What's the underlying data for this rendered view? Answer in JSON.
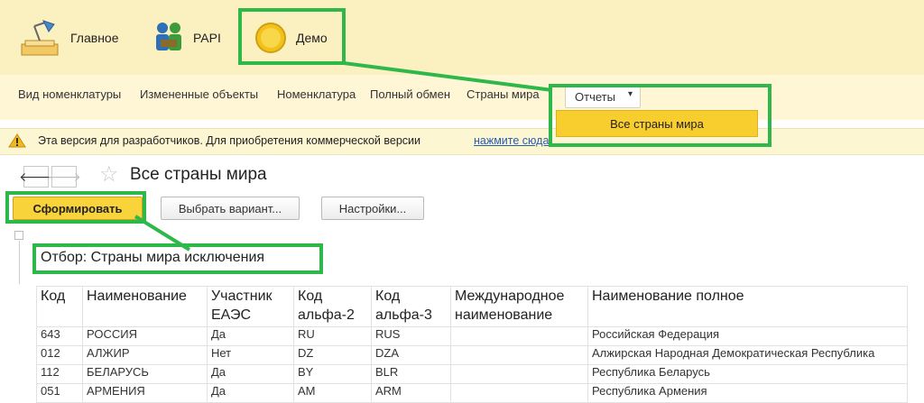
{
  "sections": [
    {
      "label": "Главное",
      "icon": "desk-lamp-icon"
    },
    {
      "label": "PAPI",
      "icon": "people-puzzle-icon"
    },
    {
      "label": "Демо",
      "icon": "yellow-circle-icon"
    }
  ],
  "nav": {
    "items": [
      "Вид номенклатуры",
      "Измененные объекты",
      "Номенклатура",
      "Полный обмен",
      "Страны мира"
    ],
    "reports_label": "Отчеты",
    "dropdown_item": "Все страны мира"
  },
  "warning": {
    "text": "Эта версия для разработчиков. Для приобретения коммерческой версии",
    "link": "нажмите сюда"
  },
  "form": {
    "title": "Все страны мира",
    "buttons": {
      "generate": "Сформировать",
      "choose_variant": "Выбрать вариант...",
      "settings": "Настройки..."
    }
  },
  "report": {
    "filter": "Отбор:   Страны мира исключения",
    "headers": [
      [
        "Код"
      ],
      [
        "Наименование"
      ],
      [
        "Участник",
        "ЕАЭС"
      ],
      [
        "Код",
        "альфа-2"
      ],
      [
        "Код",
        "альфа-3"
      ],
      [
        "Международное",
        "наименование"
      ],
      [
        "Наименование полное"
      ]
    ],
    "rows": [
      [
        "643",
        "РОССИЯ",
        "Да",
        "RU",
        "RUS",
        "",
        "Российская Федерация"
      ],
      [
        "012",
        "АЛЖИР",
        "Нет",
        "DZ",
        "DZA",
        "",
        "Алжирская Народная Демократическая Республика"
      ],
      [
        "112",
        "БЕЛАРУСЬ",
        "Да",
        "BY",
        "BLR",
        "",
        "Республика Беларусь"
      ],
      [
        "051",
        "АРМЕНИЯ",
        "Да",
        "AM",
        "ARM",
        "",
        "Республика Армения"
      ]
    ]
  },
  "colors": {
    "highlight": "#2fb84a",
    "accent": "#f8cd2e",
    "panel": "#fbf0c0"
  }
}
